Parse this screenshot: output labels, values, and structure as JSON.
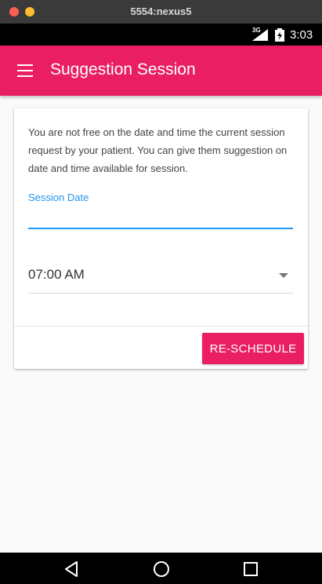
{
  "window": {
    "title": "5554:nexus5"
  },
  "status_bar": {
    "network": "3G",
    "time": "3:03"
  },
  "app_bar": {
    "title": "Suggestion Session",
    "menu_icon": "hamburger-menu-icon"
  },
  "card": {
    "message": "You are not free on the date and time the current session request by your patient. You can give them suggestion on date and time available for session.",
    "date_field": {
      "label": "Session Date",
      "value": ""
    },
    "time_select": {
      "selected": "07:00 AM"
    },
    "reschedule_label": "RE-SCHEDULE"
  },
  "nav_bar": {
    "back_icon": "back-icon",
    "home_icon": "home-icon",
    "recents_icon": "recents-icon"
  },
  "colors": {
    "primary": "#e91e63",
    "accent": "#2196f3"
  }
}
